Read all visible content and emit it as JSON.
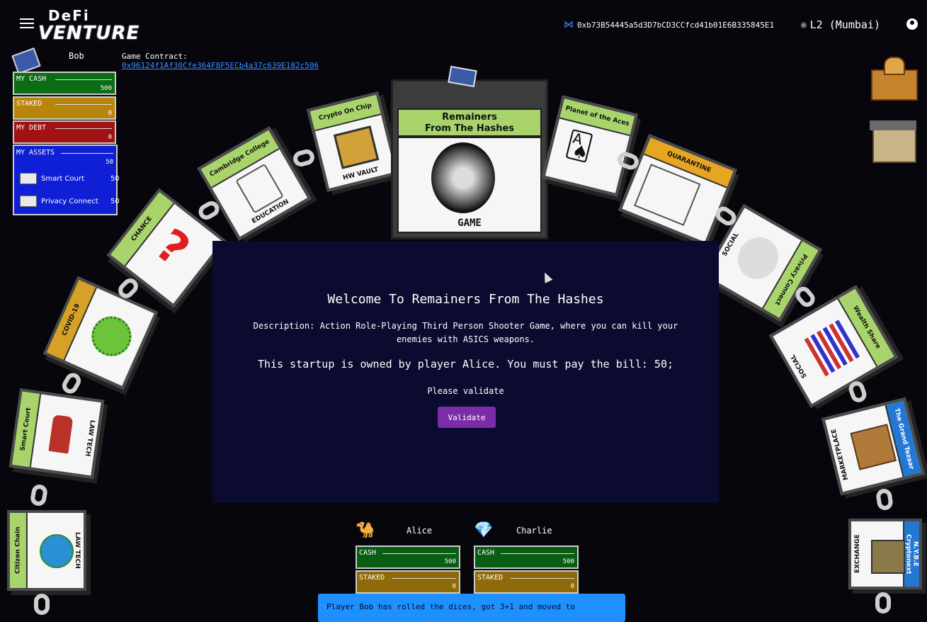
{
  "header": {
    "logo_top": "DeFi",
    "logo_bottom": "VENTURE",
    "wallet_address": "0xb73B54445a5d3D7bCD3CCfcd41b01E6B335845E1",
    "network_label": "L2 (Mumbai)"
  },
  "player": {
    "name": "Bob",
    "game_contract_label": "Game Contract:",
    "game_contract_address": "0x96124f1Af30Cfe364F8F5ECb4a37c639E182c506",
    "cash_label": "MY CASH",
    "cash_value": "500",
    "staked_label": "STAKED",
    "staked_value": "0",
    "debt_label": "MY DEBT",
    "debt_value": "0",
    "assets_label": "MY ASSETS",
    "assets_value": "50",
    "assets": [
      {
        "name": "Smart Court",
        "value": "50"
      },
      {
        "name": "Privacy Connect",
        "value": "50"
      }
    ]
  },
  "board": {
    "center": {
      "title_line1": "Remainers",
      "title_line2": "From The Hashes",
      "type": "GAME"
    },
    "tiles": [
      {
        "band": "Citizen Chain",
        "sub": "LAW TECH"
      },
      {
        "band": "Smart Court",
        "sub": "LAW TECH"
      },
      {
        "band": "COVID-19",
        "sub": ""
      },
      {
        "band": "CHANCE",
        "sub": ""
      },
      {
        "band": "Cambridge College",
        "sub": "EDUCATION"
      },
      {
        "band": "Crypto On Chip",
        "sub": "HW VAULT"
      },
      {
        "band": "Planet of the Aces",
        "sub": ""
      },
      {
        "band": "QUARANTINE",
        "sub": ""
      },
      {
        "band": "Privacy Connect",
        "sub": "SOCIAL"
      },
      {
        "band": "Wealth Share",
        "sub": "SOCIAL"
      },
      {
        "band": "The Grand Tezaar",
        "sub": "MARKETPLACE"
      },
      {
        "band": "N.Y.B.E Cryptonext",
        "sub": "EXCHANGE"
      }
    ]
  },
  "modal": {
    "title": "Welcome To Remainers From The Hashes",
    "description": "Description: Action Role-Playing Third Person Shooter Game, where you can kill your enemies with ASICS weapons.",
    "owned_text": "This startup is owned by player Alice. You must pay the bill: 50;",
    "please_validate": "Please validate",
    "validate_button": "Validate"
  },
  "opponents": [
    {
      "name": "Alice",
      "cash_label": "CASH",
      "cash_value": "500",
      "staked_label": "STAKED",
      "staked_value": "0"
    },
    {
      "name": "Charlie",
      "cash_label": "CASH",
      "cash_value": "500",
      "staked_label": "STAKED",
      "staked_value": "0"
    }
  ],
  "toast": {
    "message": "Player Bob has rolled the dices, got 3+1 and moved to"
  },
  "colors": {
    "cash": "#0a6d14",
    "staked": "#b8860b",
    "debt": "#a11212",
    "assets": "#0f1fd6",
    "validate": "#7b2da8",
    "toast": "#1e90ff"
  },
  "icons": [
    "menu-icon",
    "bifrost-icon",
    "gear-icon",
    "account-icon",
    "camel-icon",
    "diamond-icon"
  ]
}
